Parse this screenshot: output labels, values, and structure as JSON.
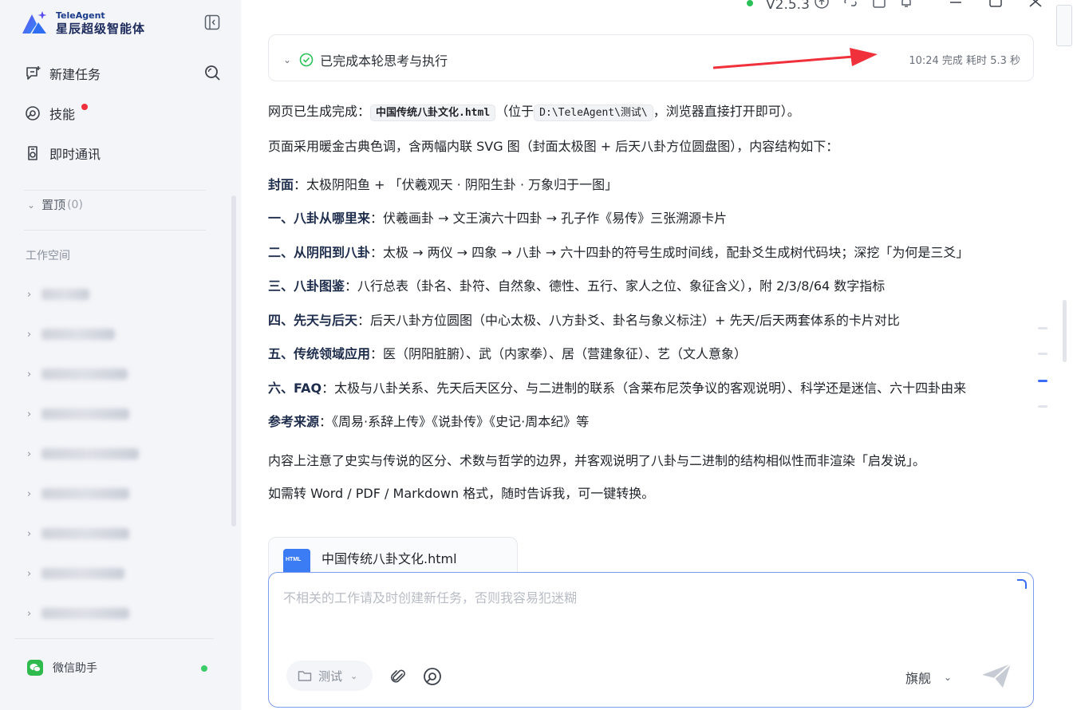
{
  "brand": {
    "name_en": "TeleAgent",
    "name_cn": "星辰超级智能体"
  },
  "sidebar": {
    "nav": [
      {
        "label": "新建任务",
        "icon": "new-task-icon"
      },
      {
        "label": "技能",
        "icon": "skill-icon"
      },
      {
        "label": "即时通讯",
        "icon": "chat-icon"
      }
    ],
    "pinned_label": "置顶",
    "pinned_count": "(0)",
    "workspace_title": "工作空间",
    "wechat_label": "微信助手"
  },
  "window": {
    "version": "V2.5.3"
  },
  "status": {
    "label": "已完成本轮思考与执行",
    "time": "10:24 完成 耗时 5.3 秒"
  },
  "message": {
    "l1_pre": "网页已生成完成：",
    "l1_file": "中国传统八卦文化.html",
    "l1_mid": "（位于",
    "l1_path": "D:\\TeleAgent\\测试\\",
    "l1_post": "，浏览器直接打开即可）。",
    "l2": "页面采用暖金古典色调，含两幅内联 SVG 图（封面太极图 + 后天八卦方位圆盘图），内容结构如下：",
    "sections": [
      {
        "head": "封面",
        "body": "：太极阴阳鱼 + 「伏羲观天 · 阴阳生卦 · 万象归于一图」"
      },
      {
        "head": "一、八卦从哪里来",
        "body": "：伏羲画卦 → 文王演六十四卦 → 孔子作《易传》三张溯源卡片"
      },
      {
        "head": "二、从阴阳到八卦",
        "body": "：太极 → 两仪 → 四象 → 八卦 → 六十四卦的符号生成时间线，配卦爻生成树代码块；深挖「为何是三爻」"
      },
      {
        "head": "三、八卦图鉴",
        "body": "：八行总表（卦名、卦符、自然象、德性、五行、家人之位、象征含义），附 2/3/8/64 数字指标"
      },
      {
        "head": "四、先天与后天",
        "body": "：后天八卦方位圆图（中心太极、八方卦爻、卦名与象义标注）+ 先天/后天两套体系的卡片对比"
      },
      {
        "head": "五、传统领域应用",
        "body": "：医（阴阳脏腑）、武（内家拳）、居（营建象征）、艺（文人意象）"
      },
      {
        "head": "六、FAQ",
        "body": "：太极与八卦关系、先天后天区分、与二进制的联系（含莱布尼茨争议的客观说明）、科学还是迷信、六十四卦由来"
      },
      {
        "head": "参考来源",
        "body": "：《周易·系辞上传》《说卦传》《史记·周本纪》等"
      }
    ],
    "note": "内容上注意了史实与传说的区分、术数与哲学的边界，并客观说明了八卦与二进制的结构相似性而非渲染「启发说」。",
    "closing": "如需转 Word / PDF / Markdown 格式，随时告诉我，可一键转换。"
  },
  "file_card": {
    "name": "中国传统八卦文化.html",
    "badge": "HTML"
  },
  "composer": {
    "placeholder": "不相关的工作请及时创建新任务，否则我容易犯迷糊",
    "folder": "测试",
    "model": "旗舰"
  },
  "colors": {
    "accent": "#3b6cf5",
    "annotation_arrow": "#f0313c",
    "status_ok": "#2bc158"
  }
}
